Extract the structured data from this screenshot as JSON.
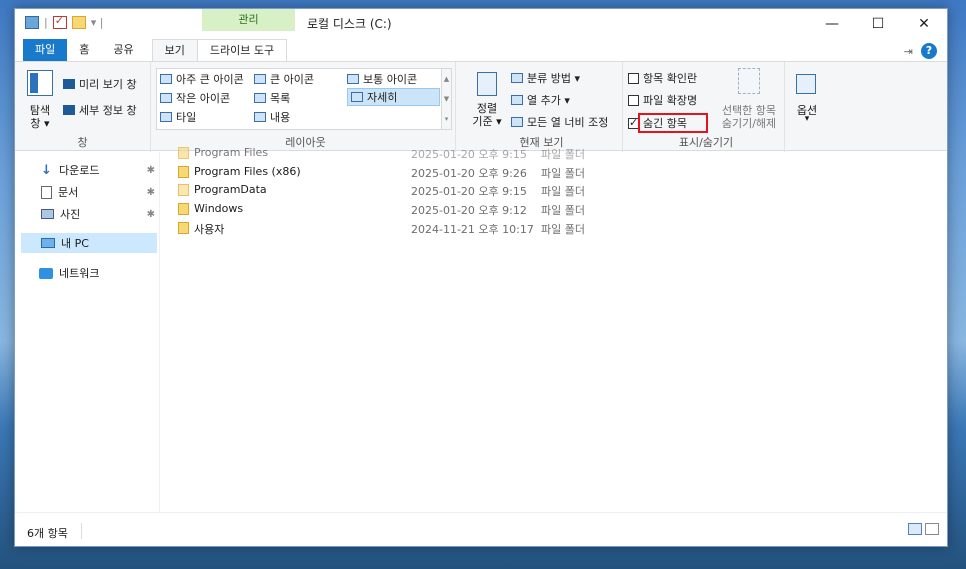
{
  "titlebar": {
    "context_tab": "관리",
    "title": "로컬 디스크 (C:)",
    "minimize": "—",
    "maximize": "☐",
    "close": "✕"
  },
  "tabs": {
    "file": "파일",
    "home": "홈",
    "share": "공유",
    "view": "보기",
    "drive_tools": "드라이브 도구"
  },
  "ribbon": {
    "pane": {
      "nav_pane": "탐색\n창",
      "nav_pane_top": "탐색",
      "nav_pane_bottom": "창 ▾",
      "preview": "미리 보기 창",
      "details": "세부 정보 창",
      "label": "창"
    },
    "layout": {
      "xl_icons": "아주 큰 아이콘",
      "large_icons": "큰 아이콘",
      "medium_icons": "보통 아이콘",
      "small_icons": "작은 아이콘",
      "list": "목록",
      "details": "자세히",
      "tiles": "타일",
      "content": "내용",
      "label": "레이아웃"
    },
    "current_view": {
      "sort_top": "정렬",
      "sort_bottom": "기준 ▾",
      "group_by": "분류 방법 ▾",
      "add_columns": "열 추가 ▾",
      "size_columns": "모든 열 너비 조정",
      "label": "현재 보기"
    },
    "show_hide": {
      "item_checkboxes": "항목 확인란",
      "file_extensions": "파일 확장명",
      "hidden_items": "숨긴 항목",
      "hide_selected_top": "선택한 항목",
      "hide_selected_bottom": "숨기기/해제",
      "label": "표시/숨기기"
    },
    "options": {
      "label": "옵션",
      "arrow": "▾"
    }
  },
  "nav": {
    "items": [
      {
        "label": "다운로드",
        "icon": "download-arrow-icon"
      },
      {
        "label": "문서",
        "icon": "document-icon"
      },
      {
        "label": "사진",
        "icon": "pictures-icon"
      },
      {
        "label": "내 PC",
        "icon": "this-pc-icon"
      },
      {
        "label": "네트워크",
        "icon": "network-icon"
      }
    ],
    "pin": "📌"
  },
  "files": [
    {
      "name": "Program Files",
      "date": "2025-01-20 오후 9:15",
      "type": "파일 폴더"
    },
    {
      "name": "Program Files (x86)",
      "date": "2025-01-20 오후 9:26",
      "type": "파일 폴더"
    },
    {
      "name": "ProgramData",
      "date": "2025-01-20 오후 9:15",
      "type": "파일 폴더"
    },
    {
      "name": "Windows",
      "date": "2025-01-20 오후 9:12",
      "type": "파일 폴더"
    },
    {
      "name": "사용자",
      "date": "2024-11-21 오후 10:17",
      "type": "파일 폴더"
    }
  ],
  "status": {
    "count": "6개 항목"
  },
  "colors": {
    "accent": "#1979ca",
    "highlight_box": "#e5131c",
    "context_tab_bg": "#d7f0c6"
  }
}
